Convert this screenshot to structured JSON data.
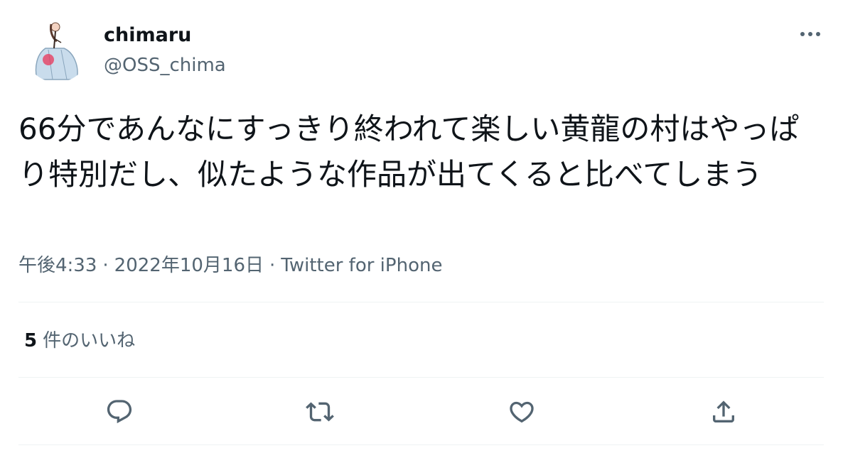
{
  "user": {
    "display_name": "chimaru",
    "handle": "@OSS_chima",
    "avatar_icon": "avatar-illustration"
  },
  "more_icon": "more-horizontal-icon",
  "tweet": {
    "text": "66分であんなにすっきり終われて楽しい黄龍の村はやっぱり特別だし、似たような作品が出てくると比べてしまう",
    "time": "午後4:33",
    "separator_1": "·",
    "date": "2022年10月16日",
    "separator_2": "·",
    "source": "Twitter for iPhone"
  },
  "stats": {
    "likes_count": "5",
    "likes_label": "件のいいね"
  },
  "actions": [
    {
      "icon": "reply-icon"
    },
    {
      "icon": "retweet-icon"
    },
    {
      "icon": "like-heart-icon"
    },
    {
      "icon": "share-icon"
    }
  ],
  "colors": {
    "text_primary": "#0f1419",
    "text_secondary": "#536471",
    "divider": "#eff3f4"
  }
}
